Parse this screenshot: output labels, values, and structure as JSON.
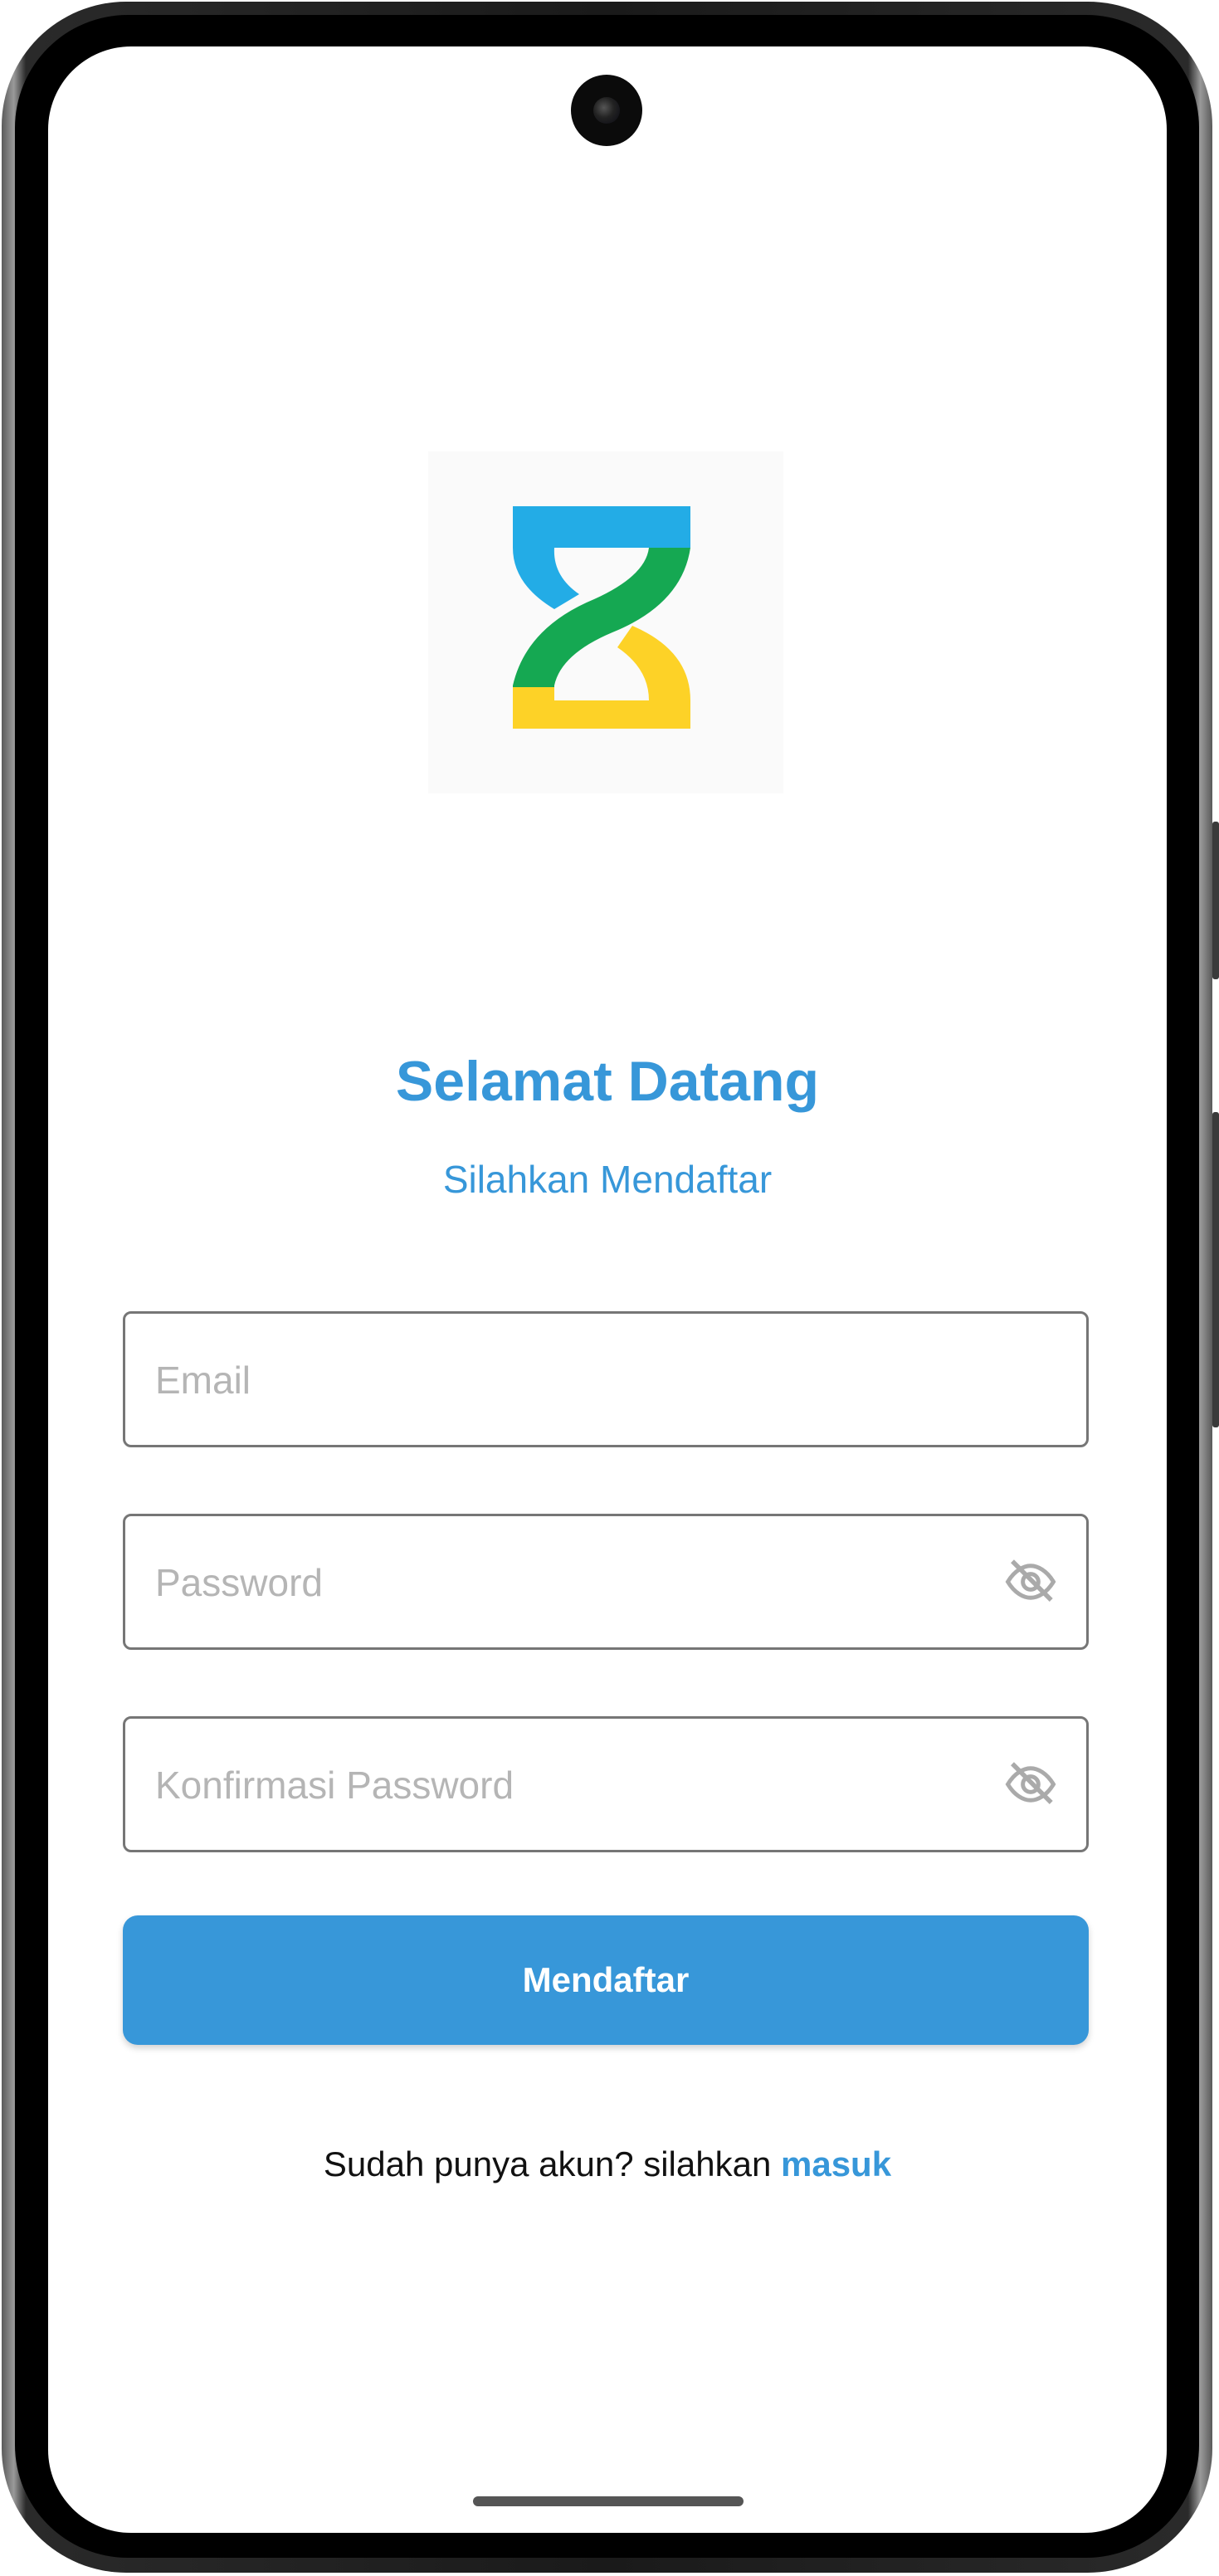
{
  "app": {
    "logo_icon": "hourglass-logo",
    "colors": {
      "primary": "#3797d9",
      "logo_blue": "#23ace6",
      "logo_green": "#15a852",
      "logo_yellow": "#fdd227"
    }
  },
  "header": {
    "title": "Selamat Datang",
    "subtitle": "Silahkan Mendaftar"
  },
  "form": {
    "email": {
      "placeholder": "Email",
      "value": ""
    },
    "password": {
      "placeholder": "Password",
      "value": "",
      "toggle_icon": "eye-off-icon"
    },
    "confirm_password": {
      "placeholder": "Konfirmasi Password",
      "value": "",
      "toggle_icon": "eye-off-icon"
    },
    "submit_label": "Mendaftar"
  },
  "footer": {
    "prompt": "Sudah punya akun? silahkan ",
    "link_label": "masuk"
  }
}
